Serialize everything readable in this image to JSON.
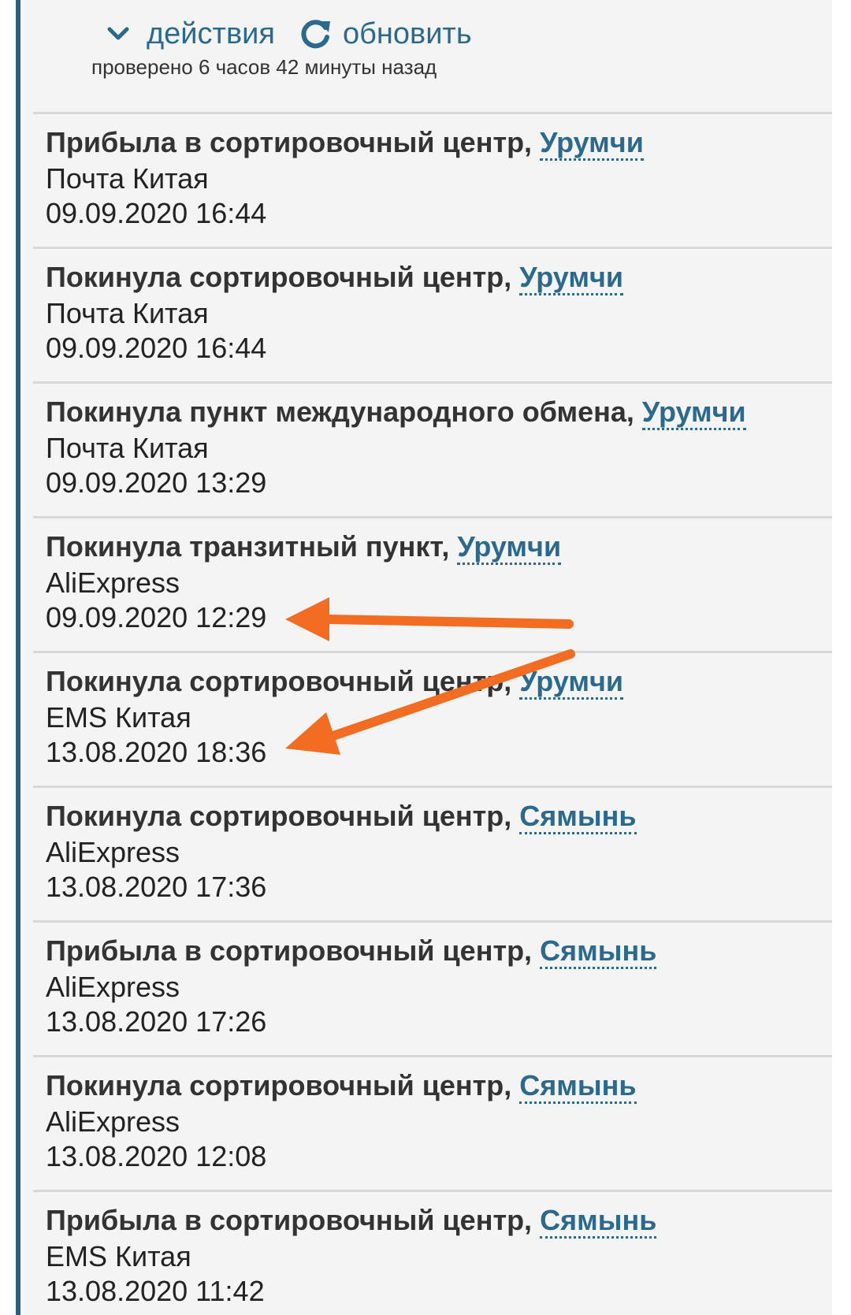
{
  "toolbar": {
    "actions_label": "действия",
    "refresh_label": "обновить",
    "checked_text": "проверено 6 часов 42 минуты назад"
  },
  "events": [
    {
      "title": "Прибыла в сортировочный центр, ",
      "location": "Урумчи",
      "carrier": "Почта Китая",
      "date": "09.09.2020 16:44"
    },
    {
      "title": "Покинула сортировочный центр, ",
      "location": "Урумчи",
      "carrier": "Почта Китая",
      "date": "09.09.2020 16:44"
    },
    {
      "title": "Покинула пункт международного обмена, ",
      "location": "Урумчи",
      "carrier": "Почта Китая",
      "date": "09.09.2020 13:29"
    },
    {
      "title": "Покинула транзитный пункт, ",
      "location": "Урумчи",
      "carrier": "AliExpress",
      "date": "09.09.2020 12:29"
    },
    {
      "title": "Покинула сортировочный центр, ",
      "location": "Урумчи",
      "carrier": "EMS Китая",
      "date": "13.08.2020 18:36"
    },
    {
      "title": "Покинула сортировочный центр, ",
      "location": "Сямынь",
      "carrier": "AliExpress",
      "date": "13.08.2020 17:36"
    },
    {
      "title": "Прибыла в сортировочный центр, ",
      "location": "Сямынь",
      "carrier": "AliExpress",
      "date": "13.08.2020 17:26"
    },
    {
      "title": "Покинула сортировочный центр, ",
      "location": "Сямынь",
      "carrier": "AliExpress",
      "date": "13.08.2020 12:08"
    },
    {
      "title": "Прибыла в сортировочный центр, ",
      "location": "Сямынь",
      "carrier": "EMS Китая",
      "date": "13.08.2020 11:42"
    }
  ],
  "annotations": {
    "arrow_color": "#f26d21",
    "arrows": [
      {
        "points_to_event": 3
      },
      {
        "points_to_event": 4
      }
    ]
  },
  "colors": {
    "link": "#2b6a8e",
    "accent_border": "#2c5e82",
    "panel_bg": "#f4f4f4"
  },
  "icons": {
    "actions": "chevron-down-icon",
    "refresh": "refresh-icon"
  }
}
